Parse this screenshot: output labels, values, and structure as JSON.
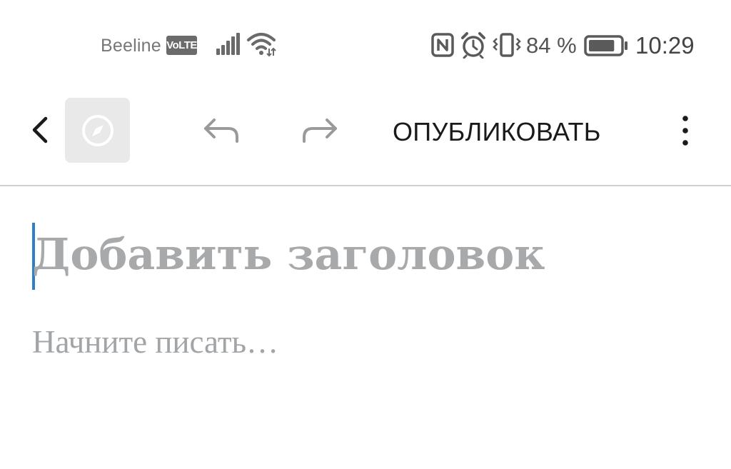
{
  "status_bar": {
    "carrier": "Beeline",
    "network_badge": "VoLTE",
    "battery_percent": "84 %",
    "battery_level": 0.84,
    "time": "10:29",
    "icons": [
      "signal-icon",
      "wifi-icon",
      "nfc-icon",
      "alarm-icon",
      "vibrate-icon",
      "battery-icon"
    ]
  },
  "toolbar": {
    "publish_label": "ОПУБЛИКОВАТЬ",
    "icons": [
      "back-icon",
      "compass-icon",
      "undo-icon",
      "redo-icon",
      "more-vertical-icon"
    ]
  },
  "editor": {
    "title_placeholder": "Добавить заголовок",
    "body_placeholder": "Начните писать…"
  },
  "colors": {
    "accent_caret": "#2d7fc7",
    "placeholder": "#a7a9ab",
    "divider": "#d0d0d0"
  }
}
